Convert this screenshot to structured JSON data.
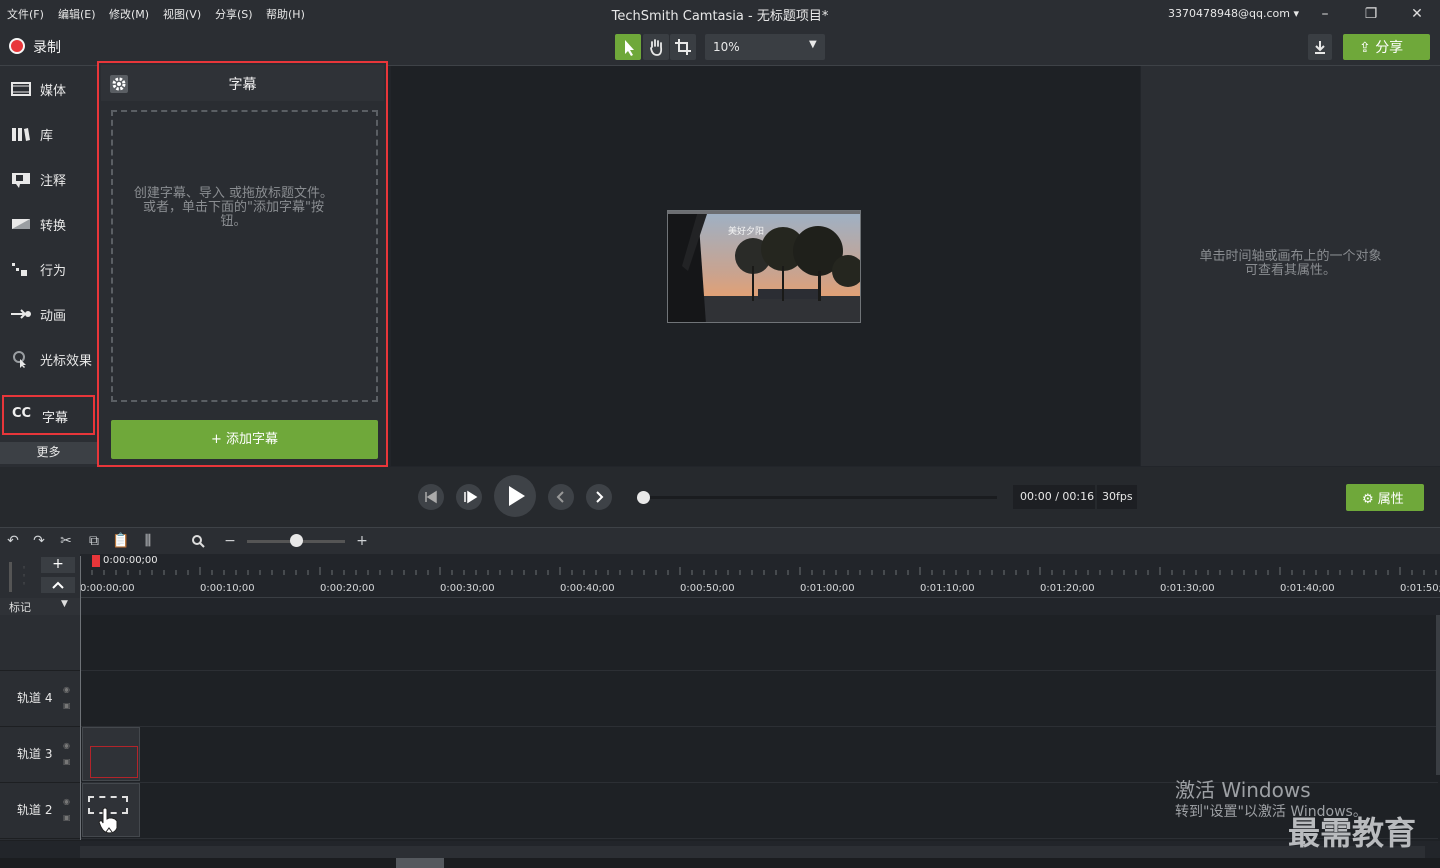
{
  "app": {
    "title": "TechSmith Camtasia - 无标题项目*",
    "account": "3370478948@qq.com"
  },
  "menu": [
    "文件(F)",
    "编辑(E)",
    "修改(M)",
    "视图(V)",
    "分享(S)",
    "帮助(H)"
  ],
  "toolbar": {
    "record": "录制",
    "zoom": "10%",
    "share": "分享"
  },
  "sidebar": {
    "items": [
      {
        "label": "媒体",
        "icon": "film-icon"
      },
      {
        "label": "库",
        "icon": "library-icon"
      },
      {
        "label": "注释",
        "icon": "annotation-icon"
      },
      {
        "label": "转换",
        "icon": "transition-icon"
      },
      {
        "label": "行为",
        "icon": "behavior-icon"
      },
      {
        "label": "动画",
        "icon": "animation-icon"
      },
      {
        "label": "光标效果",
        "icon": "cursor-effect-icon"
      }
    ],
    "captions_cc": "CC",
    "captions": "字幕",
    "more": "更多"
  },
  "captions_panel": {
    "title": "字幕",
    "hint_line1": "创建字幕、导入 或拖放标题文件。",
    "hint_line2": "或者，单击下面的\"添加字幕\"按",
    "hint_line3": "钮。",
    "add_button": "+ 添加字幕"
  },
  "canvas": {
    "preview_caption": "美好夕阳"
  },
  "properties": {
    "hint_line1": "单击时间轴或画布上的一个对象",
    "hint_line2": "可查看其属性。"
  },
  "playback": {
    "timecode": "00:00 / 00:16",
    "fps": "30fps",
    "properties_button": "属性"
  },
  "timeline": {
    "playhead": "0:00:00;00",
    "marker": "标记",
    "ticks": [
      "0:00:00;00",
      "0:00:10;00",
      "0:00:20;00",
      "0:00:30;00",
      "0:00:40;00",
      "0:00:50;00",
      "0:01:00;00",
      "0:01:10;00",
      "0:01:20;00",
      "0:01:30;00",
      "0:01:40;00",
      "0:01:50;"
    ],
    "tracks": [
      "轨道 4",
      "轨道 3",
      "轨道 2"
    ]
  },
  "watermark": {
    "line1": "激活 Windows",
    "line2": "转到\"设置\"以激活 Windows。",
    "brand": "最需教育"
  },
  "colors": {
    "accent": "#6fa83a",
    "highlight": "#e8363a",
    "background": "#22252a"
  }
}
